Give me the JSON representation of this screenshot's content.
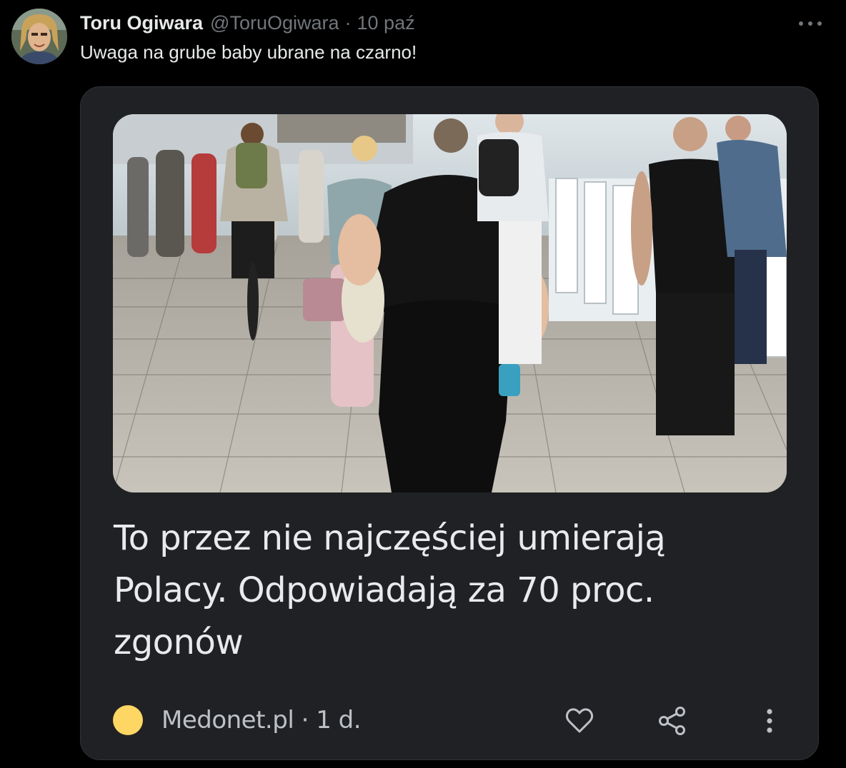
{
  "tweet": {
    "author": {
      "display_name": "Toru Ogiwara",
      "handle": "@ToruOgiwara",
      "separator": "·",
      "timestamp": "10 paź",
      "avatar_icon": "user-avatar"
    },
    "text": "Uwaga na grube baby ubrane na czarno!",
    "more_icon": "more-horizontal-icon"
  },
  "media": {
    "article": {
      "title": "To przez nie najczęściej umierają Polacy. Odpowiadają za 70 proc. zgonów",
      "source": "Medonet.pl · 1 d.",
      "source_logo_color": "#fdd663",
      "actions": {
        "like_icon": "heart-icon",
        "share_icon": "share-icon",
        "menu_icon": "more-vertical-icon"
      }
    }
  },
  "colors": {
    "background": "#000000",
    "text_primary": "#e7e9ea",
    "text_secondary": "#71767b",
    "card_background": "#202124"
  }
}
